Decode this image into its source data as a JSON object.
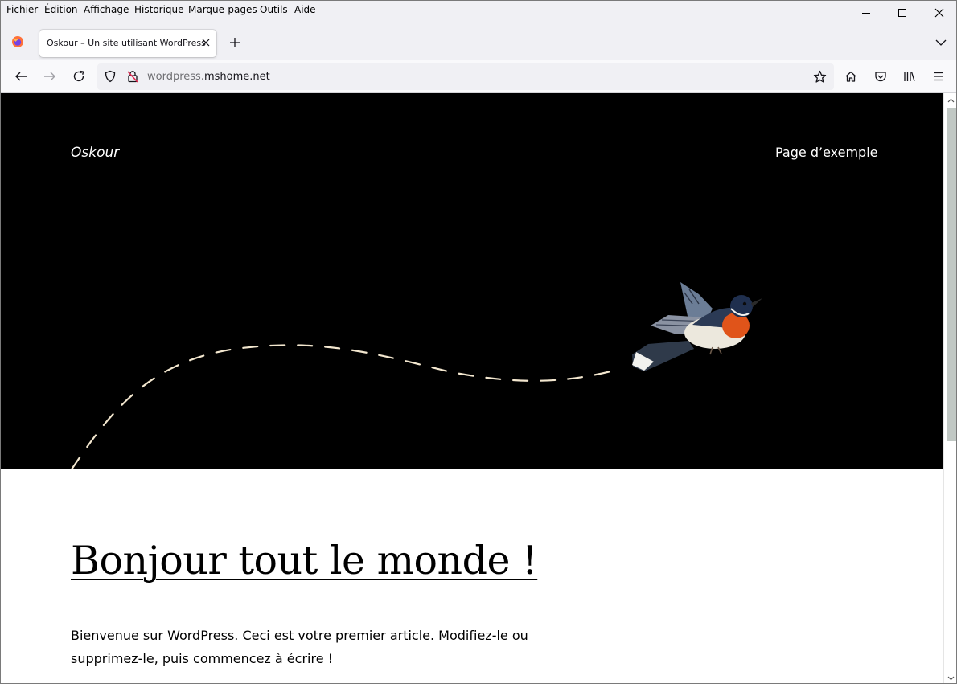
{
  "menubar": {
    "items": [
      "Fichier",
      "Édition",
      "Affichage",
      "Historique",
      "Marque-pages",
      "Outils",
      "Aide"
    ]
  },
  "tabs": {
    "active_title": "Oskour – Un site utilisant WordPress"
  },
  "navbar": {
    "url_host_dim": "wordpress.",
    "url_host_main": "mshome.net"
  },
  "site": {
    "title": "Oskour",
    "nav_link": "Page d’exemple"
  },
  "post": {
    "title": "Bonjour tout le monde !",
    "excerpt": "Bienvenue sur WordPress. Ceci est votre premier article. Modifiez-le ou supprimez-le, puis commencez à écrire !"
  },
  "colors": {
    "header_bg": "#000000",
    "dash_line": "#f3e7cf",
    "bird_breast": "#e0541a"
  },
  "icons": {
    "back": "arrow-left-icon",
    "forward": "arrow-right-icon",
    "reload": "reload-icon",
    "shield": "tracking-shield-icon",
    "insecure": "insecure-lock-icon",
    "bookmark": "star-icon",
    "home": "home-icon",
    "pocket": "pocket-icon",
    "library": "library-icon",
    "menu": "hamburger-menu-icon"
  }
}
